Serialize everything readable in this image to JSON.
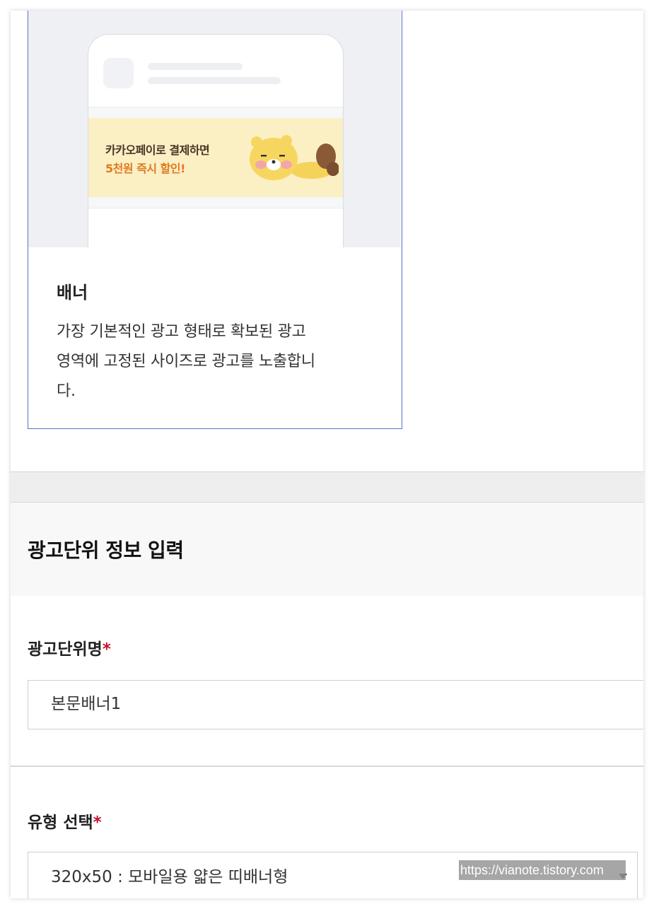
{
  "card": {
    "banner_line1": "카카오페이로 결제하면",
    "banner_line2": "5천원 즉시 할인!",
    "title": "배너",
    "description_lines": [
      "가장 기본적인 광고 형태로 확보된 광고",
      "영역에 고정된 사이즈로 광고를 노출합니",
      "다."
    ]
  },
  "section": {
    "title": "광고단위 정보 입력"
  },
  "fields": {
    "name_label": "광고단위명",
    "name_required": "*",
    "name_value": "본문배너1",
    "type_label": "유형 선택",
    "type_required": "*",
    "type_value": "320x50 : 모바일용 얇은 띠배너형"
  },
  "watermark": "https://vianote.tistory.com",
  "colors": {
    "card_border": "#5b6fc7",
    "banner_bg": "#fbefc4",
    "banner_highlight": "#e07a1f",
    "required": "#c8102e"
  },
  "icons": {
    "select_arrow": "chevron-down-icon",
    "character": "ryan-character-illustration"
  }
}
